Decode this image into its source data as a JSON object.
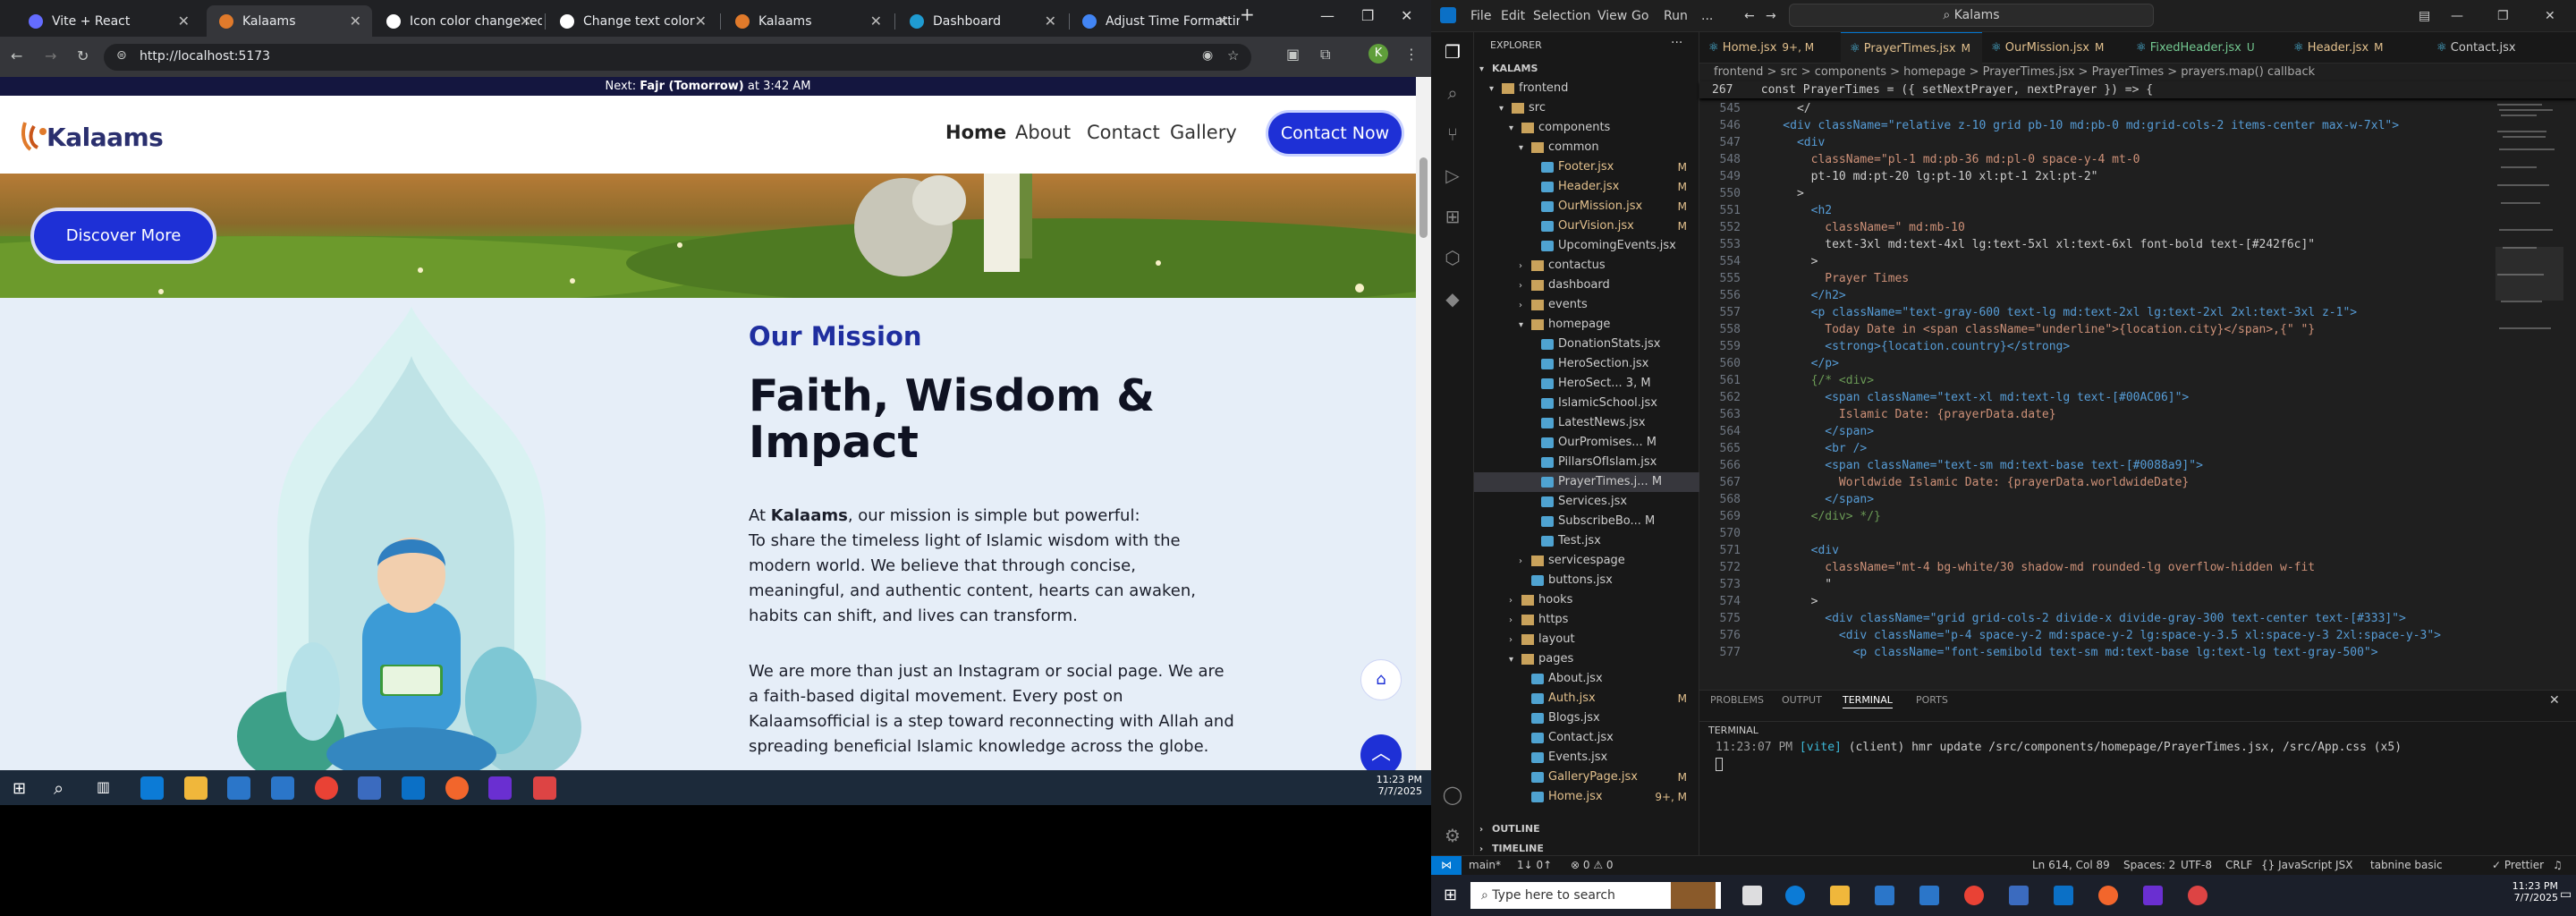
{
  "browser": {
    "tabs": [
      {
        "label": "Vite + React",
        "fav": "#646cff"
      },
      {
        "label": "Kalaams",
        "fav": "#e07a2b"
      },
      {
        "label": "Icon color change req",
        "fav": "#ffffff"
      },
      {
        "label": "Change text color",
        "fav": "#ffffff"
      },
      {
        "label": "Kalaams",
        "fav": "#e07a2b"
      },
      {
        "label": "Dashboard",
        "fav": "#1f9bd1"
      },
      {
        "label": "Adjust Time Formattin",
        "fav": "#4285f4"
      }
    ],
    "url": "http://localhost:5173",
    "avatar": "K"
  },
  "site": {
    "prayer_prefix": "Next: ",
    "prayer_name": "Fajr (Tomorrow)",
    "prayer_time": " at 3:42 AM",
    "logo": "Kalaams",
    "nav": [
      "Home",
      "About",
      "Contact",
      "Gallery"
    ],
    "contact_btn": "Contact Now",
    "discover_btn": "Discover More",
    "mission_kicker": "Our Mission",
    "mission_title": "Faith, Wisdom & Impact",
    "p1_pre": "At ",
    "p1_bold": "Kalaams",
    "p1_post": ", our mission is simple but powerful:",
    "p1_body": "To share the timeless light of Islamic wisdom with the modern world. We believe that through concise, meaningful, and authentic content, hearts can awaken, habits can shift, and lives can transform.",
    "p2": "We are more than just an Instagram or social page. We are a faith-based digital movement. Every post on Kalaamsofficial is a step toward reconnecting with Allah and spreading beneficial Islamic knowledge across the globe."
  },
  "taskbar_left": {
    "time": "11:23 PM",
    "date": "7/7/2025"
  },
  "vscode": {
    "menu": [
      "File",
      "Edit",
      "Selection",
      "View",
      "Go",
      "Run",
      "..."
    ],
    "search": "Kalams",
    "explorer_title": "EXPLORER",
    "root": "KALAMS",
    "tree": [
      {
        "t": "frontend",
        "d": 1,
        "k": "open",
        "m": ""
      },
      {
        "t": "src",
        "d": 2,
        "k": "open",
        "m": ""
      },
      {
        "t": "components",
        "d": 3,
        "k": "open",
        "m": ""
      },
      {
        "t": "common",
        "d": 4,
        "k": "open",
        "m": ""
      },
      {
        "t": "Footer.jsx",
        "d": 5,
        "k": "file",
        "m": "M"
      },
      {
        "t": "Header.jsx",
        "d": 5,
        "k": "file",
        "m": "M"
      },
      {
        "t": "OurMission.jsx",
        "d": 5,
        "k": "file",
        "m": "M"
      },
      {
        "t": "OurVision.jsx",
        "d": 5,
        "k": "file",
        "m": "M"
      },
      {
        "t": "UpcomingEvents.jsx",
        "d": 5,
        "k": "file",
        "m": ""
      },
      {
        "t": "contactus",
        "d": 4,
        "k": "closed",
        "m": ""
      },
      {
        "t": "dashboard",
        "d": 4,
        "k": "closed",
        "m": ""
      },
      {
        "t": "events",
        "d": 4,
        "k": "closed",
        "m": ""
      },
      {
        "t": "homepage",
        "d": 4,
        "k": "open",
        "m": ""
      },
      {
        "t": "DonationStats.jsx",
        "d": 5,
        "k": "file",
        "m": ""
      },
      {
        "t": "HeroSection.jsx",
        "d": 5,
        "k": "file",
        "m": ""
      },
      {
        "t": "HeroSect... 3, M",
        "d": 5,
        "k": "file",
        "m": ""
      },
      {
        "t": "IslamicSchool.jsx",
        "d": 5,
        "k": "file",
        "m": ""
      },
      {
        "t": "LatestNews.jsx",
        "d": 5,
        "k": "file",
        "m": ""
      },
      {
        "t": "OurPromises... M",
        "d": 5,
        "k": "file",
        "m": ""
      },
      {
        "t": "PillarsOfIslam.jsx",
        "d": 5,
        "k": "file",
        "m": ""
      },
      {
        "t": "PrayerTimes.j... M",
        "d": 5,
        "k": "file",
        "m": "",
        "sel": true
      },
      {
        "t": "Services.jsx",
        "d": 5,
        "k": "file",
        "m": ""
      },
      {
        "t": "SubscribeBo... M",
        "d": 5,
        "k": "file",
        "m": ""
      },
      {
        "t": "Test.jsx",
        "d": 5,
        "k": "file",
        "m": ""
      },
      {
        "t": "servicespage",
        "d": 4,
        "k": "closed",
        "m": ""
      },
      {
        "t": "buttons.jsx",
        "d": 4,
        "k": "file",
        "m": ""
      },
      {
        "t": "hooks",
        "d": 3,
        "k": "closed",
        "m": ""
      },
      {
        "t": "https",
        "d": 3,
        "k": "closed",
        "m": ""
      },
      {
        "t": "layout",
        "d": 3,
        "k": "closed",
        "m": ""
      },
      {
        "t": "pages",
        "d": 3,
        "k": "open",
        "m": ""
      },
      {
        "t": "About.jsx",
        "d": 4,
        "k": "file",
        "m": ""
      },
      {
        "t": "Auth.jsx",
        "d": 4,
        "k": "file",
        "m": "M"
      },
      {
        "t": "Blogs.jsx",
        "d": 4,
        "k": "file",
        "m": ""
      },
      {
        "t": "Contact.jsx",
        "d": 4,
        "k": "file",
        "m": ""
      },
      {
        "t": "Events.jsx",
        "d": 4,
        "k": "file",
        "m": ""
      },
      {
        "t": "GalleryPage.jsx",
        "d": 4,
        "k": "file",
        "m": "M"
      },
      {
        "t": "Home.jsx",
        "d": 4,
        "k": "file",
        "m": "9+, M"
      }
    ],
    "outline": "OUTLINE",
    "timeline": "TIMELINE",
    "tabs": [
      {
        "t": "Home.jsx",
        "s": "9+, M",
        "c": "#e2c08d"
      },
      {
        "t": "PrayerTimes.jsx",
        "s": "M",
        "c": "#e2c08d",
        "active": true
      },
      {
        "t": "OurMission.jsx",
        "s": "M",
        "c": "#e2c08d"
      },
      {
        "t": "FixedHeader.jsx",
        "s": "U",
        "c": "#73c991"
      },
      {
        "t": "Header.jsx",
        "s": "M",
        "c": "#e2c08d"
      },
      {
        "t": "Contact.jsx",
        "s": "",
        "c": "#ccc"
      }
    ],
    "breadcrumb": "frontend > src > components > homepage > PrayerTimes.jsx > PrayerTimes > prayers.map() callback",
    "sticky": "267    const PrayerTimes = ({ setNextPrayer, nextPrayer }) => {",
    "lines": [
      {
        "n": "545",
        "c": "      </"
      },
      {
        "n": "546",
        "c": "    <div className=\"relative z-10 grid pb-10 md:pb-0 md:grid-cols-2 items-center max-w-7xl\">"
      },
      {
        "n": "547",
        "c": "      <div"
      },
      {
        "n": "548",
        "c": "        className=\"pl-1 md:pb-36 md:pl-0 space-y-4 mt-0"
      },
      {
        "n": "549",
        "c": "        pt-10 md:pt-20 lg:pt-10 xl:pt-1 2xl:pt-2\""
      },
      {
        "n": "550",
        "c": "      >"
      },
      {
        "n": "551",
        "c": "        <h2"
      },
      {
        "n": "552",
        "c": "          className=\" md:mb-10"
      },
      {
        "n": "553",
        "c": "          text-3xl md:text-4xl lg:text-5xl xl:text-6xl font-bold text-[#242f6c]\""
      },
      {
        "n": "554",
        "c": "        >"
      },
      {
        "n": "555",
        "c": "          Prayer Times"
      },
      {
        "n": "556",
        "c": "        </h2>"
      },
      {
        "n": "557",
        "c": "        <p className=\"text-gray-600 text-lg md:text-2xl lg:text-2xl 2xl:text-3xl z-1\">"
      },
      {
        "n": "558",
        "c": "          Today Date in <span className=\"underline\">{location.city}</span>,{\" \"}"
      },
      {
        "n": "559",
        "c": "          <strong>{location.country}</strong>"
      },
      {
        "n": "560",
        "c": "        </p>"
      },
      {
        "n": "561",
        "c": "        {/* <div>"
      },
      {
        "n": "562",
        "c": "          <span className=\"text-xl md:text-lg text-[#00AC06]\">"
      },
      {
        "n": "563",
        "c": "            Islamic Date: {prayerData.date}"
      },
      {
        "n": "564",
        "c": "          </span>"
      },
      {
        "n": "565",
        "c": "          <br />"
      },
      {
        "n": "566",
        "c": "          <span className=\"text-sm md:text-base text-[#0088a9]\">"
      },
      {
        "n": "567",
        "c": "            Worldwide Islamic Date: {prayerData.worldwideDate}"
      },
      {
        "n": "568",
        "c": "          </span>"
      },
      {
        "n": "569",
        "c": "        </div> */}"
      },
      {
        "n": "570",
        "c": ""
      },
      {
        "n": "571",
        "c": "        <div"
      },
      {
        "n": "572",
        "c": "          className=\"mt-4 bg-white/30 shadow-md rounded-lg overflow-hidden w-fit"
      },
      {
        "n": "573",
        "c": "          \""
      },
      {
        "n": "574",
        "c": "        >"
      },
      {
        "n": "575",
        "c": "          <div className=\"grid grid-cols-2 divide-x divide-gray-300 text-center text-[#333]\">"
      },
      {
        "n": "576",
        "c": "            <div className=\"p-4 space-y-2 md:space-y-2 lg:space-y-3.5 xl:space-y-3 2xl:space-y-3\">"
      },
      {
        "n": "577",
        "c": "              <p className=\"font-semibold text-sm md:text-base lg:text-lg text-gray-500\">"
      }
    ],
    "panel_tabs": [
      "PROBLEMS",
      "OUTPUT",
      "TERMINAL",
      "PORTS"
    ],
    "terminal_label": "TERMINAL",
    "term_time": "11:23:07 PM",
    "term_vite": "[vite]",
    "term_msg": "(client) hmr update /src/components/homepage/PrayerTimes.jsx, /src/App.css (x5)",
    "status": {
      "branch": "main*",
      "sync": "1↓ 0↑",
      "errors": "⊗ 0 ⚠ 0",
      "pos": "Ln 614, Col 89",
      "spaces": "Spaces: 2",
      "enc": "UTF-8",
      "eol": "CRLF",
      "lang": "{} JavaScript JSX",
      "tabnine": "tabnine basic",
      "prettier": "✓ Prettier"
    },
    "win": {
      "search": "Type here to search",
      "time": "11:23 PM",
      "date": "7/7/2025"
    }
  }
}
